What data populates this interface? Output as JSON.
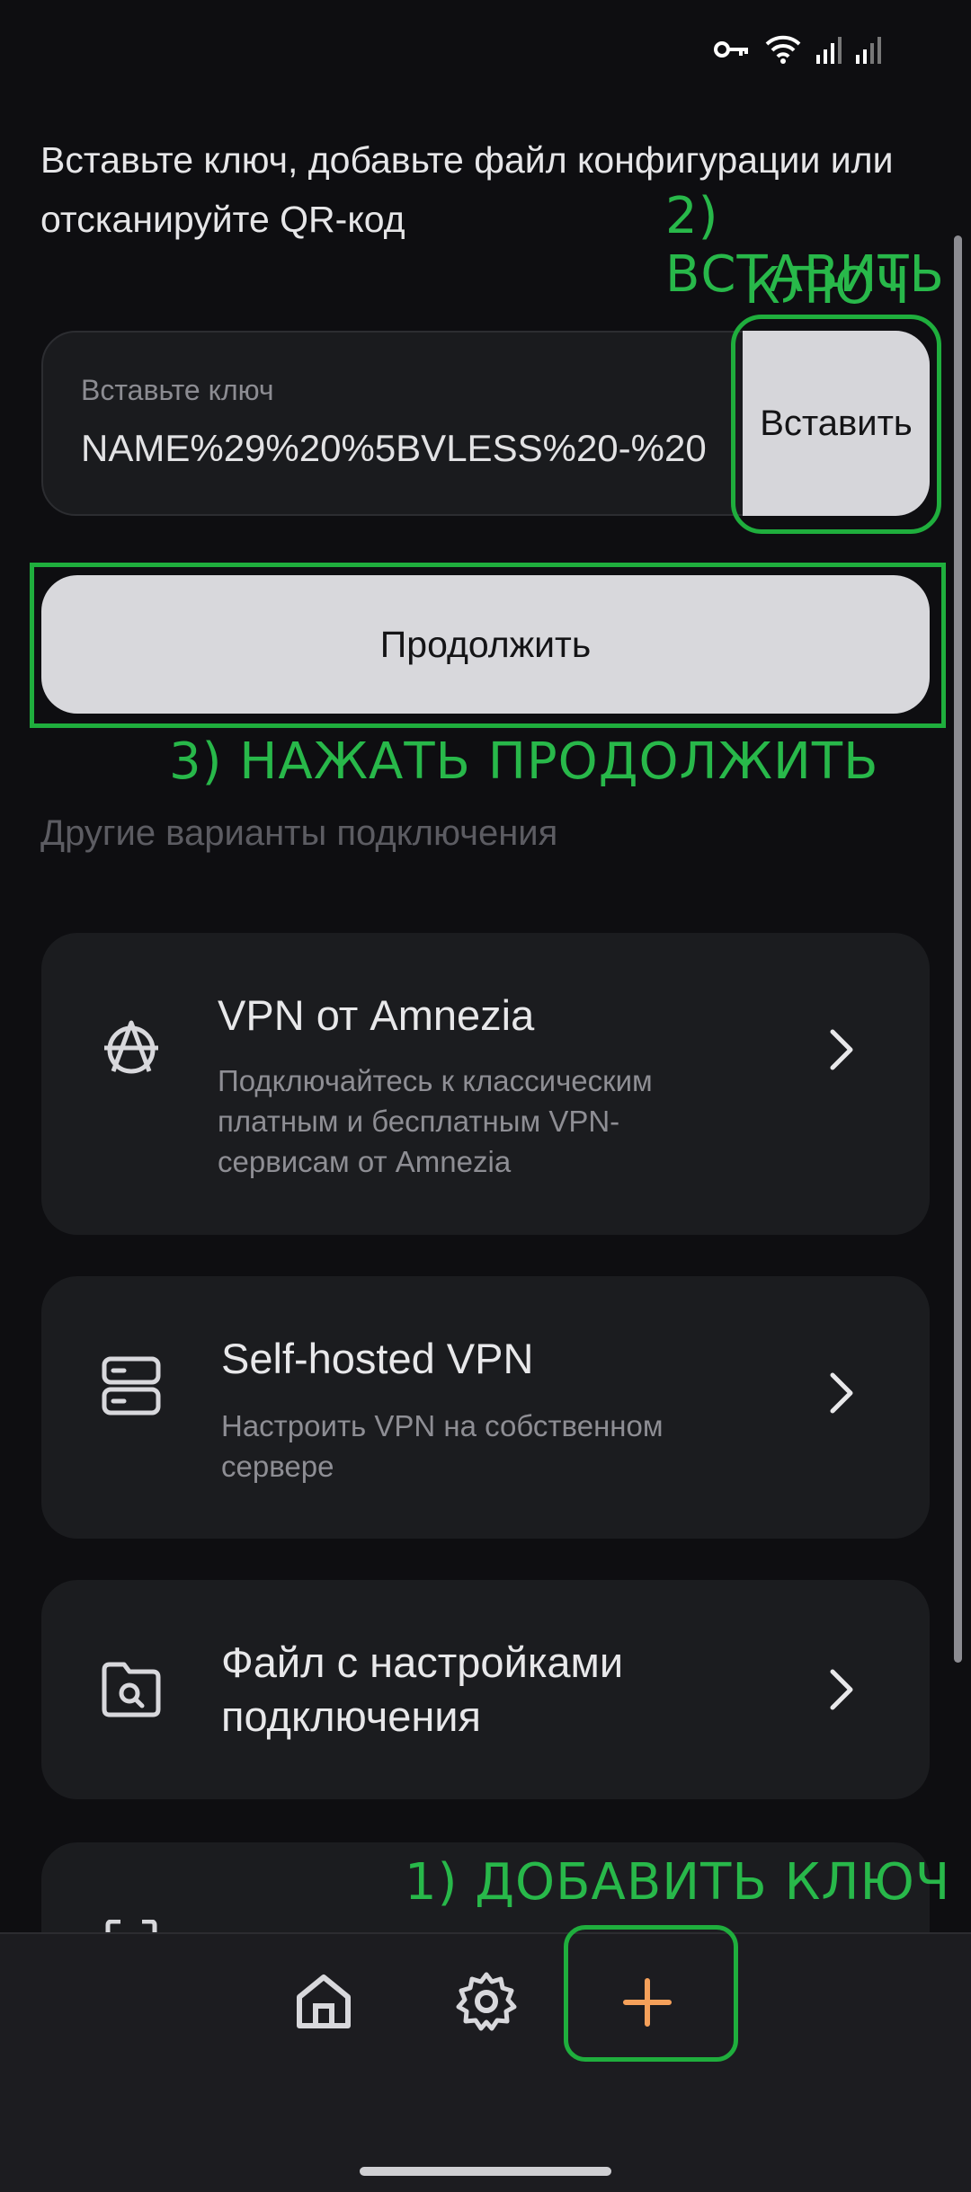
{
  "intro_text": "Вставьте ключ, добавьте файл конфигурации или отсканируйте QR-код",
  "key_input": {
    "label": "Вставьте ключ",
    "value": "NAME%29%20%5BVLESS%20-%20"
  },
  "paste_button": "Вставить",
  "continue_button": "Продолжить",
  "other_options_label": "Другие варианты подключения",
  "options": [
    {
      "icon": "amnezia-icon",
      "title": "VPN от Amnezia",
      "desc_lines": [
        "Подключайтесь к классическим",
        "платным и бесплатным VPN-",
        "сервисам от Amnezia"
      ]
    },
    {
      "icon": "server-icon",
      "title": "Self-hosted VPN",
      "desc_lines": [
        "Настроить VPN на собственном",
        "сервере"
      ]
    },
    {
      "icon": "folder-search-icon",
      "title_lines": [
        "Файл с настройками",
        "подключения"
      ]
    }
  ],
  "annotations": {
    "step1": "1) ДОБАВИТЬ КЛЮЧ",
    "step2_line1": "2) ВСТАВИТЬ",
    "step2_line2": "КЛЮЧ",
    "step3": "3) НАЖАТЬ ПРОДОЛЖИТЬ"
  },
  "bottom_nav": [
    {
      "icon": "home-icon"
    },
    {
      "icon": "gear-icon"
    },
    {
      "icon": "plus-icon",
      "active": true
    }
  ],
  "colors": {
    "background": "#0e0e11",
    "card": "#1b1c1f",
    "annotation_green": "#28b84a",
    "accent_orange": "#f5a05a"
  }
}
